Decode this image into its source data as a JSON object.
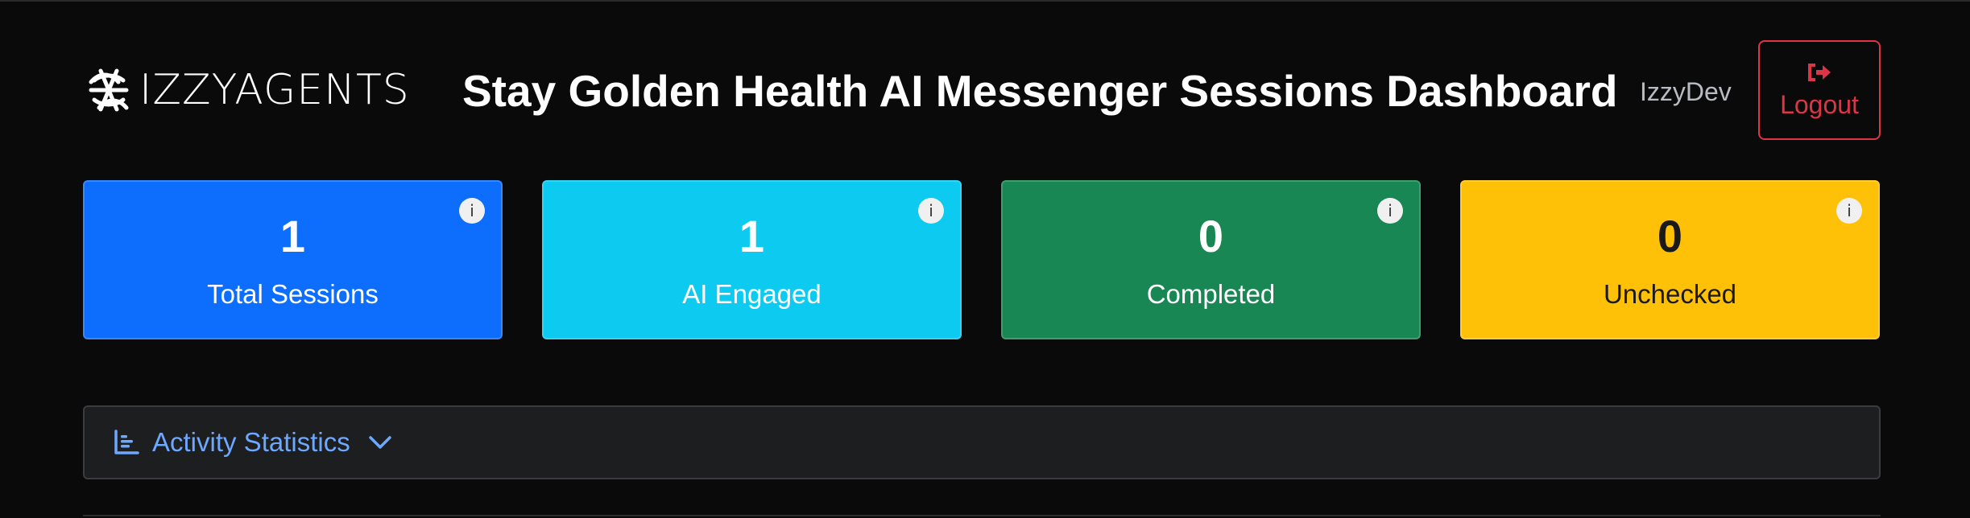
{
  "header": {
    "brand": "IZZYAGENTS",
    "title": "Stay Golden Health AI Messenger Sessions Dashboard",
    "username": "IzzyDev",
    "logout_label": "Logout",
    "logout_icon": "sign-out-icon"
  },
  "stats": [
    {
      "value": "1",
      "label": "Total Sessions",
      "color": "#0d6efd",
      "text_color": "#ffffff",
      "info": "i"
    },
    {
      "value": "1",
      "label": "AI Engaged",
      "color": "#0dcaf0",
      "text_color": "#ffffff",
      "info": "i"
    },
    {
      "value": "0",
      "label": "Completed",
      "color": "#198754",
      "text_color": "#ffffff",
      "info": "i"
    },
    {
      "value": "0",
      "label": "Unchecked",
      "color": "#ffc107",
      "text_color": "#1a1a1a",
      "info": "i"
    }
  ],
  "activity": {
    "label": "Activity Statistics",
    "icon": "bar-chart-icon",
    "toggle_icon": "chevron-down-icon",
    "accent": "#6ea8fe"
  },
  "colors": {
    "background": "#0a0a0a",
    "danger": "#dc3545",
    "muted_text": "#b8bcc2"
  }
}
